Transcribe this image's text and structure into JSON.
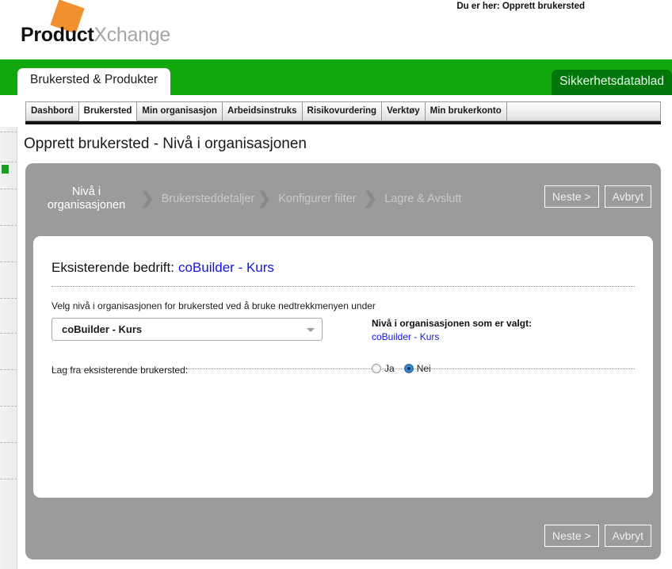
{
  "header": {
    "logo_bold": "Product",
    "logo_light": "Xchange",
    "breadcrumb": "Du er her: Opprett brukersted",
    "main_tab": "Brukersted & Produkter",
    "right_tab": "Sikkerhetsdatablad",
    "accent_green": "#11a80e",
    "accent_dark_green": "#00760b",
    "logo_orange": "#f0912d"
  },
  "subnav": {
    "items": [
      {
        "label": "Dashbord",
        "active": false
      },
      {
        "label": "Brukersted",
        "active": true
      },
      {
        "label": "Min organisasjon",
        "active": false
      },
      {
        "label": "Arbeidsinstruks",
        "active": false
      },
      {
        "label": "Risikovurdering",
        "active": false
      },
      {
        "label": "Verktøy",
        "active": false
      },
      {
        "label": "Min brukerkonto",
        "active": false
      }
    ]
  },
  "page": {
    "title": "Opprett brukersted - Nivå i organisasjonen"
  },
  "wizard": {
    "steps": [
      {
        "label": "Nivå i organisasjonen",
        "active": true
      },
      {
        "label": "Brukersteddetaljer",
        "active": false
      },
      {
        "label": "Konfigurer filter",
        "active": false
      },
      {
        "label": "Lagre & Avslutt",
        "active": false
      }
    ],
    "separator": "›",
    "next_label": "Neste >",
    "cancel_label": "Avbryt"
  },
  "form": {
    "heading_label": "Eksisterende bedrift:",
    "heading_company": "coBuilder - Kurs",
    "hint": "Velg nivå i organisasjonen for brukersted ved å bruke nedtrekkmenyen under",
    "select_value": "coBuilder - Kurs",
    "selected_label": "Nivå i organisasjonen som er valgt:",
    "selected_value": "coBuilder - Kurs",
    "existing_row_label": "Lag fra eksisterende brukersted:",
    "radio_yes": "Ja",
    "radio_no": "Nei",
    "radio_selected": "Nei",
    "link_color": "#1414e6"
  }
}
